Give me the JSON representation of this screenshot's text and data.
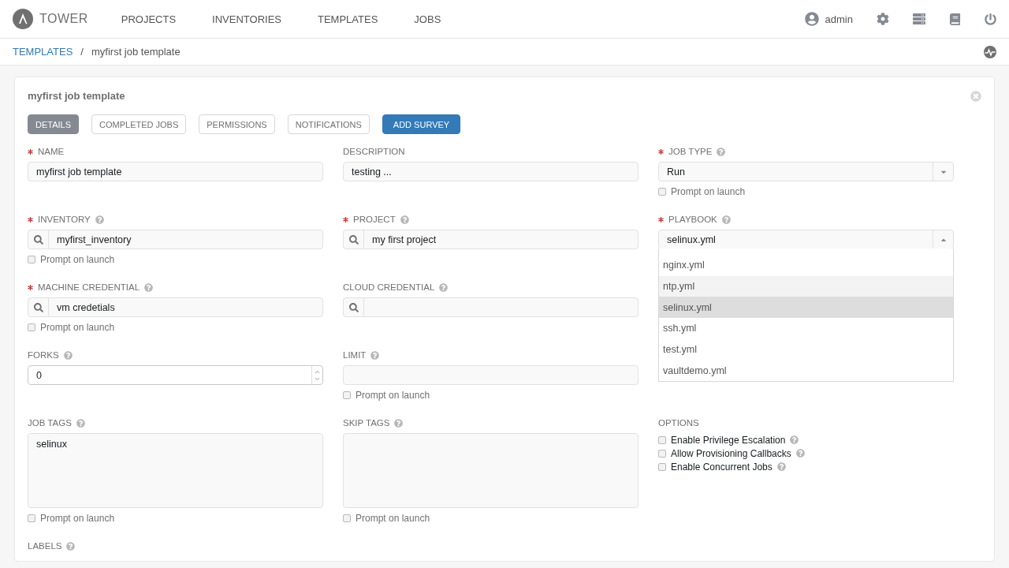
{
  "nav": {
    "brand": "TOWER",
    "items": [
      {
        "label": "PROJECTS"
      },
      {
        "label": "INVENTORIES"
      },
      {
        "label": "TEMPLATES"
      },
      {
        "label": "JOBS"
      }
    ],
    "user": "admin"
  },
  "breadcrumb": {
    "parent": "TEMPLATES",
    "separator": "/",
    "current": "myfirst job template"
  },
  "card": {
    "title": "myfirst job template",
    "tabs": [
      {
        "label": "DETAILS",
        "selected": true
      },
      {
        "label": "COMPLETED JOBS",
        "selected": false
      },
      {
        "label": "PERMISSIONS",
        "selected": false
      },
      {
        "label": "NOTIFICATIONS",
        "selected": false
      }
    ],
    "action": "ADD SURVEY",
    "rows": [
      [
        {
          "kind": "text",
          "label": "NAME",
          "required": true,
          "help": false,
          "value": "myfirst job template"
        },
        {
          "kind": "text",
          "label": "DESCRIPTION",
          "required": false,
          "help": false,
          "value": "testing ..."
        },
        {
          "kind": "select",
          "label": "JOB TYPE",
          "required": true,
          "help": true,
          "value": "Run",
          "open": false,
          "prompt": {
            "label": "Prompt on launch",
            "checked": false
          }
        }
      ],
      [
        {
          "kind": "lookup",
          "label": "INVENTORY",
          "required": true,
          "help": true,
          "value": "myfirst_inventory",
          "prompt": {
            "label": "Prompt on launch",
            "checked": false
          }
        },
        {
          "kind": "lookup",
          "label": "PROJECT",
          "required": true,
          "help": true,
          "value": "my first project"
        },
        {
          "kind": "select",
          "label": "PLAYBOOK",
          "required": true,
          "help": true,
          "value": "selinux.yml",
          "open": true,
          "options": [
            {
              "label": "nginx.yml",
              "selected": false,
              "highlighted": false
            },
            {
              "label": "ntp.yml",
              "selected": false,
              "highlighted": true
            },
            {
              "label": "selinux.yml",
              "selected": true,
              "highlighted": false
            },
            {
              "label": "ssh.yml",
              "selected": false,
              "highlighted": false
            },
            {
              "label": "test.yml",
              "selected": false,
              "highlighted": false
            },
            {
              "label": "vaultdemo.yml",
              "selected": false,
              "highlighted": false
            }
          ]
        }
      ],
      [
        {
          "kind": "lookup",
          "label": "MACHINE CREDENTIAL",
          "required": true,
          "help": true,
          "value": "vm credetials",
          "prompt": {
            "label": "Prompt on launch",
            "checked": false
          }
        },
        {
          "kind": "lookup",
          "label": "CLOUD CREDENTIAL",
          "required": false,
          "help": true
        }
      ],
      [
        {
          "kind": "number",
          "label": "FORKS",
          "required": false,
          "help": true,
          "value": "0"
        },
        {
          "kind": "text",
          "label": "LIMIT",
          "required": false,
          "help": true,
          "prompt": {
            "label": "Prompt on launch",
            "checked": false
          }
        }
      ],
      [
        {
          "kind": "textarea",
          "label": "JOB TAGS",
          "required": false,
          "help": true,
          "value": "selinux",
          "prompt": {
            "label": "Prompt on launch",
            "checked": false
          }
        },
        {
          "kind": "textarea",
          "label": "SKIP TAGS",
          "required": false,
          "help": true,
          "prompt": {
            "label": "Prompt on launch",
            "checked": false
          }
        },
        {
          "kind": "checks",
          "label": "OPTIONS",
          "required": false,
          "help": false,
          "options": [
            {
              "label": "Enable Privilege Escalation",
              "checked": false
            },
            {
              "label": "Allow Provisioning Callbacks",
              "checked": false
            },
            {
              "label": "Enable Concurrent Jobs",
              "checked": false
            }
          ]
        }
      ],
      [
        {
          "kind": "heading",
          "label": "LABELS",
          "required": false,
          "help": true
        }
      ]
    ]
  }
}
